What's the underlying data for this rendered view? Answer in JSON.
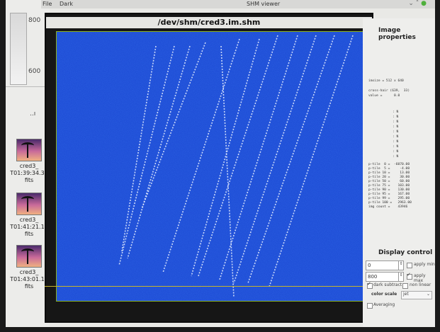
{
  "desktop": {
    "scale_ticks": [
      "800",
      "600"
    ],
    "small_tag": "..ı",
    "files": [
      {
        "name": "cred3_",
        "time": "T01:39:34.35",
        "ext": "fits"
      },
      {
        "name": "cred3_",
        "time": "T01:41:21.16",
        "ext": "fits"
      },
      {
        "name": "cred3_",
        "time": "T01:43:01.16",
        "ext": "fits"
      }
    ]
  },
  "menubar": {
    "file": "File",
    "dark": "Dark",
    "title": "SHM viewer"
  },
  "viewer": {
    "title": "/dev/shm/cred3.im.shm"
  },
  "image": {
    "background_color": "#1f4ed6",
    "stripe_color": "#e8f0ff"
  },
  "properties": {
    "title": "Image properties",
    "imsize": "imsize = 512 x 640",
    "crosshair": "cross-hair (639,  33)",
    "value": "value =      0.0",
    "list_lines": [
      ": N",
      ": N",
      ": N",
      ": N",
      ": N",
      ": N",
      ": N",
      ": N",
      ": N",
      ": N"
    ],
    "ptiles": [
      "p-tile  0 =  -6070.00",
      "p-tile  5 =     -4.00",
      "p-tile 10 =     13.00",
      "p-tile 20 =     30.00",
      "p-tile 50 =     60.00",
      "p-tile 75 =    103.00",
      "p-tile 90 =    130.00",
      "p-tile 95 =    167.00",
      "p-tile 99 =    295.00",
      "p-tile 100 =   2963.00",
      "img count =    43946"
    ]
  },
  "display_control": {
    "title": "Display control",
    "min_value": "0",
    "max_value": "800",
    "apply_min": "apply min",
    "apply_max": "apply max",
    "dark_subtract": "dark subtract",
    "non_linear": "non linear",
    "color_scale": "color scale",
    "color_scale_value": "jet",
    "averaging": "Averaging"
  }
}
